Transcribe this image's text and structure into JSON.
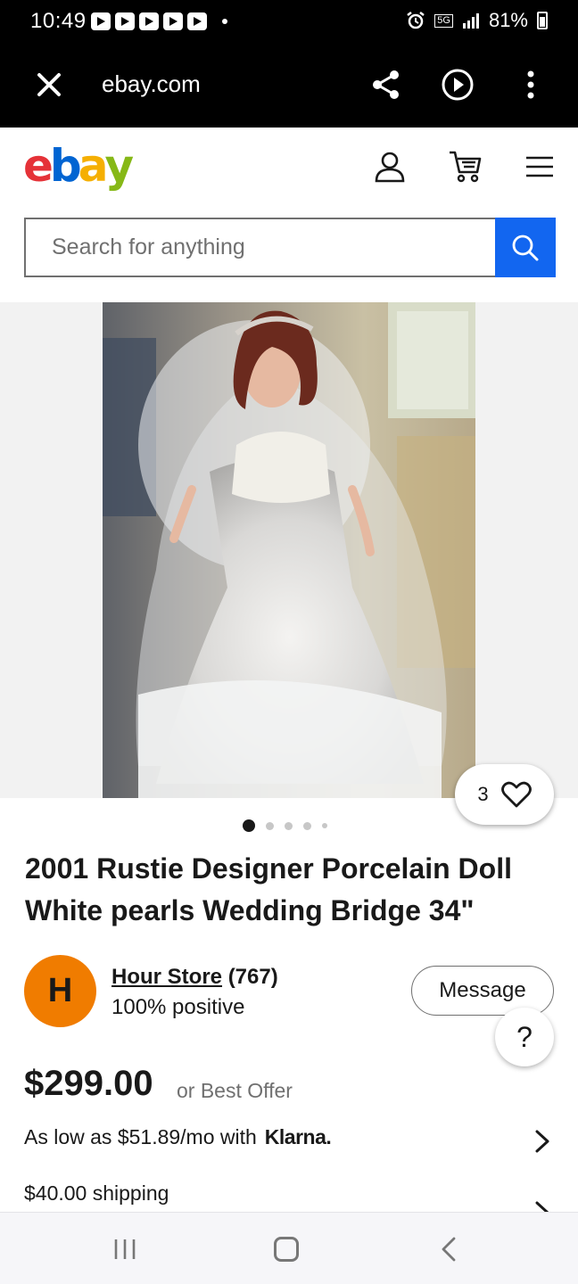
{
  "status_bar": {
    "time": "10:49",
    "network": "5G",
    "battery": "81%"
  },
  "browser": {
    "url": "ebay.com"
  },
  "header": {
    "logo_letters": [
      "e",
      "b",
      "a",
      "y"
    ],
    "logo_colors": [
      "#e53238",
      "#0064d2",
      "#f5af02",
      "#86b817"
    ],
    "search_placeholder": "Search for anything",
    "accent_color": "#1266f0"
  },
  "gallery": {
    "watch_count": "3",
    "image_count": 5,
    "active_index": 0
  },
  "listing": {
    "title": "2001 Rustie Designer Porcelain Doll White pearls Wedding Bridge 34\"",
    "seller": {
      "initial": "H",
      "name": "Hour Store",
      "feedback_count": "(767)",
      "positive": "100% positive",
      "avatar_color": "#f07c00"
    },
    "message_label": "Message",
    "help_label": "?",
    "price": "$299.00",
    "best_offer": "or Best Offer",
    "klarna_text": "As low as $51.89/mo with",
    "klarna_brand": "Klarna.",
    "shipping": "$40.00 shipping"
  }
}
